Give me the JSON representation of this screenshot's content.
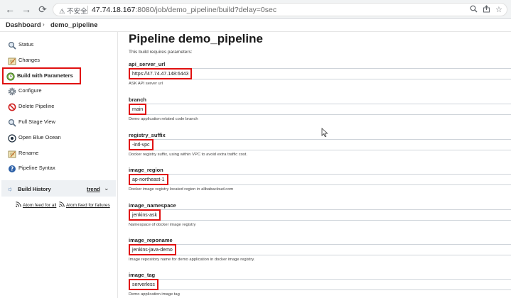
{
  "browser": {
    "security_label": "不安全",
    "url_host": "47.74.18.167",
    "url_rest": ":8080/job/demo_pipeline/build?delay=0sec"
  },
  "breadcrumb": {
    "items": [
      "Dashboard",
      "demo_pipeline"
    ]
  },
  "sidebar": {
    "items": [
      {
        "label": "Status",
        "icon": "search-icon"
      },
      {
        "label": "Changes",
        "icon": "notepad-icon"
      },
      {
        "label": "Build with Parameters",
        "icon": "build-clock-icon"
      },
      {
        "label": "Configure",
        "icon": "gear-icon"
      },
      {
        "label": "Delete Pipeline",
        "icon": "no-entry-icon"
      },
      {
        "label": "Full Stage View",
        "icon": "search-icon"
      },
      {
        "label": "Open Blue Ocean",
        "icon": "blue-ocean-icon"
      },
      {
        "label": "Rename",
        "icon": "notepad-icon"
      },
      {
        "label": "Pipeline Syntax",
        "icon": "help-icon"
      }
    ],
    "build_history": {
      "label": "Build History",
      "trend": "trend"
    },
    "feeds": {
      "all": "Atom feed for all",
      "failures": "Atom feed for failures"
    }
  },
  "main": {
    "title": "Pipeline demo_pipeline",
    "subtitle": "This build requires parameters:",
    "params": [
      {
        "name": "api_server_url",
        "value": "https://47.74.47.148:6443",
        "description": "ASK API server url"
      },
      {
        "name": "branch",
        "value": "main",
        "description": "Demo application related code branch"
      },
      {
        "name": "registry_suffix",
        "value": "-intl-vpc",
        "description": "Docker registry suffix, using within VPC to avoid extra traffic cost."
      },
      {
        "name": "image_region",
        "value": "ap-northeast-1",
        "description": "Docker image registry located region in alibabacloud.com"
      },
      {
        "name": "image_namespace",
        "value": "jenkins-ask",
        "description": "Namespace of docker image registry"
      },
      {
        "name": "image_reponame",
        "value": "jenkins-java-demo",
        "description": "Image repository name for demo application in docker image registry."
      },
      {
        "name": "image_tag",
        "value": "serverless",
        "description": "Demo application image tag"
      }
    ]
  },
  "colors": {
    "highlight": "#e01010",
    "link": "#3a6ea5"
  }
}
